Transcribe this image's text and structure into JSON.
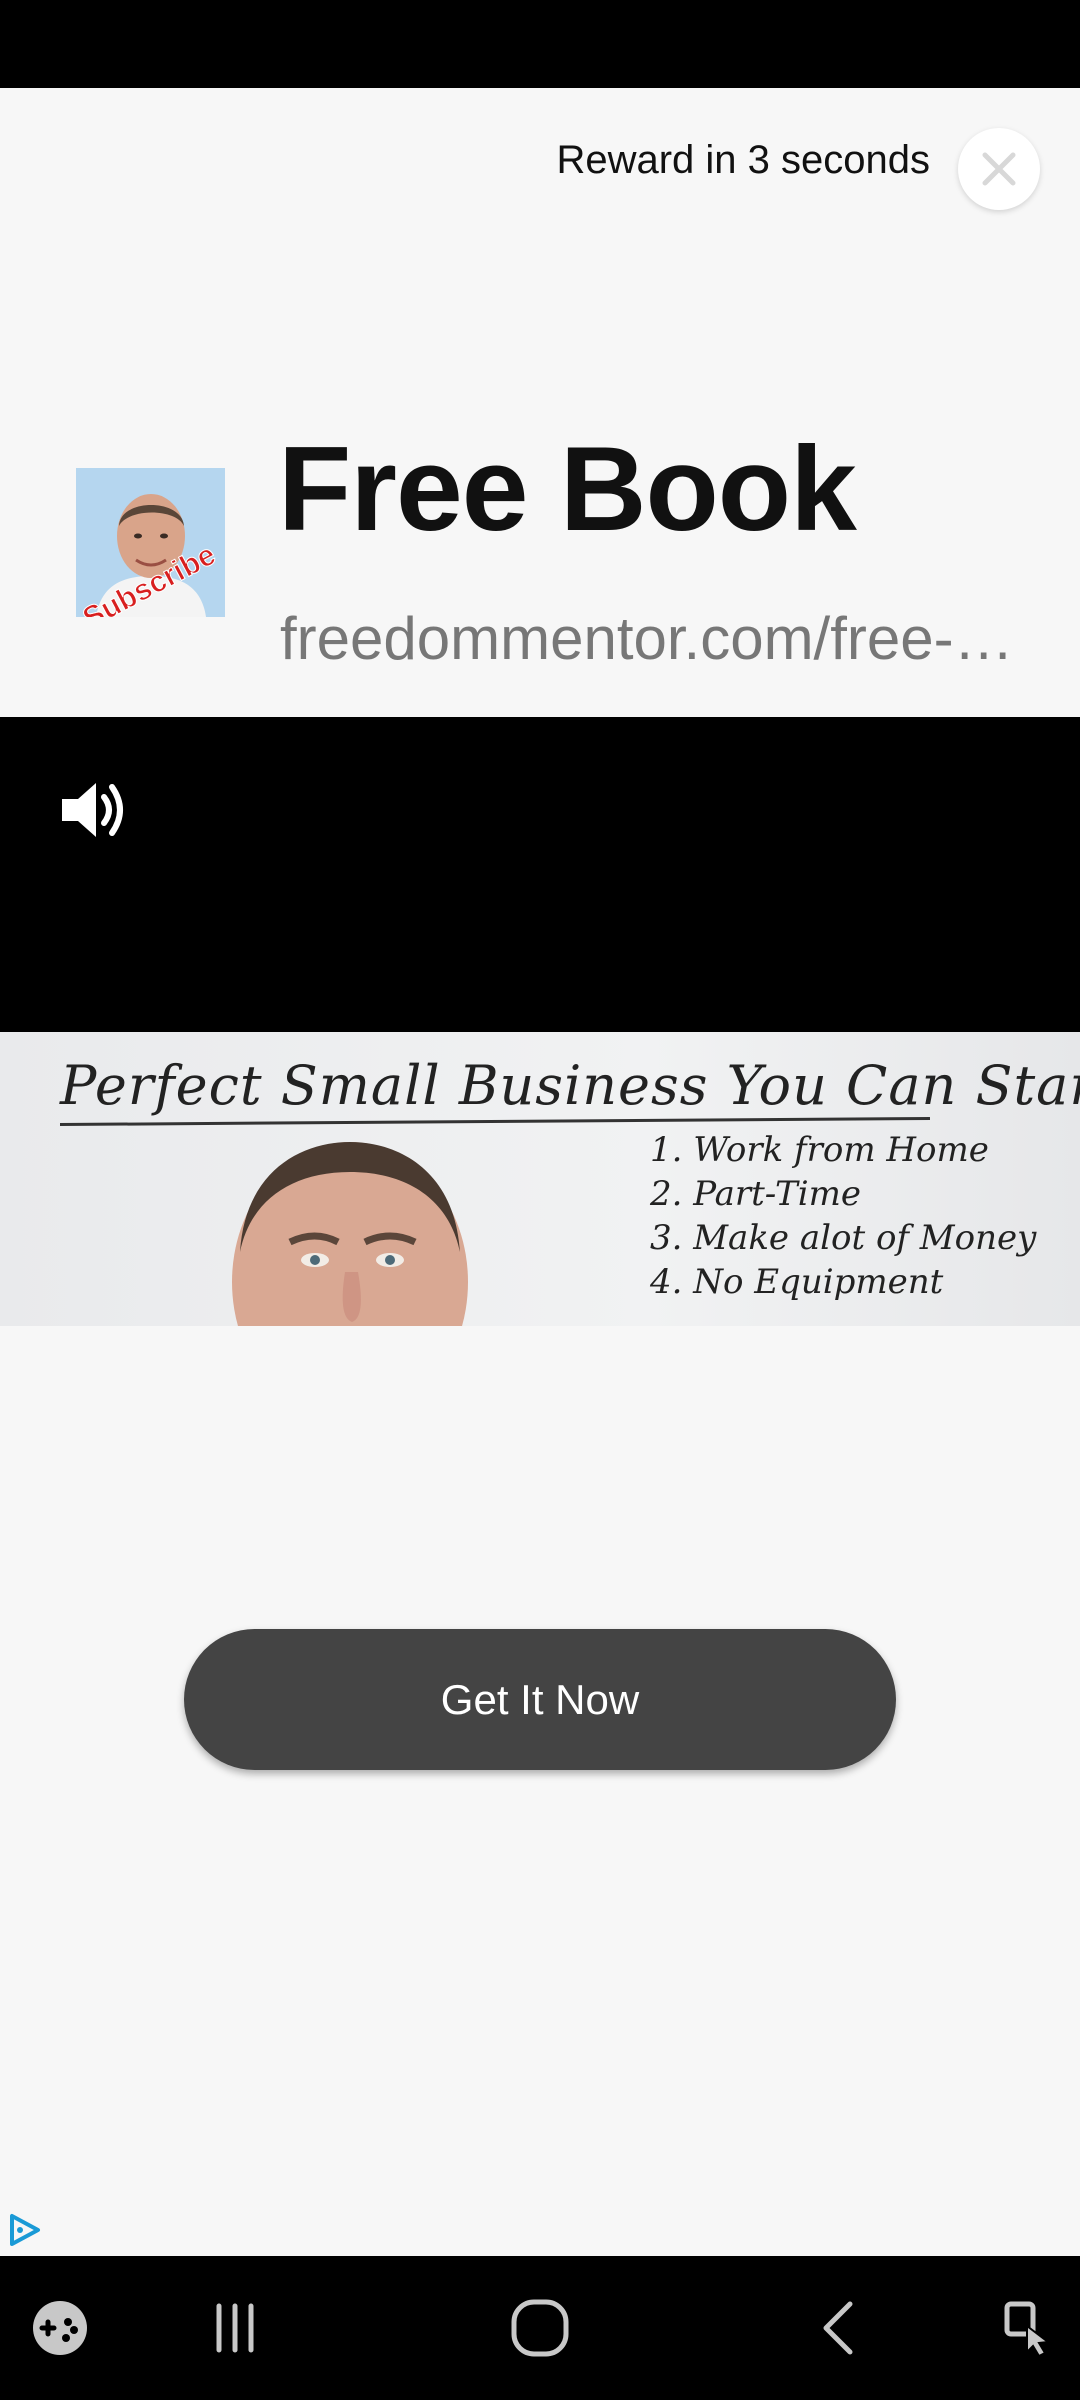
{
  "ad_header": {
    "reward_text": "Reward in 3 seconds",
    "close_icon": "close-icon"
  },
  "advertiser": {
    "avatar_badge_text": "Subscribe",
    "title": "Free Book",
    "url": "freedommentor.com/free-…"
  },
  "video": {
    "volume_icon": "volume-icon",
    "whiteboard_title": "Perfect Small Business You Can Start",
    "whiteboard_list": [
      "1. Work from Home",
      "2. Part-Time",
      "3. Make alot of Money",
      "4. No Equipment"
    ]
  },
  "cta": {
    "label": "Get It Now"
  },
  "footer": {
    "adchoices_icon": "adchoices-icon"
  },
  "nav_bar": {
    "items": [
      "game-launcher-icon",
      "recent-apps-icon",
      "home-icon",
      "back-icon",
      "accessibility-icon"
    ]
  },
  "colors": {
    "background": "#f7f7f7",
    "cta_background": "#444444",
    "adchoices": "#1a9ad6"
  }
}
